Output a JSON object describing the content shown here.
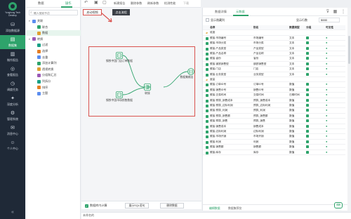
{
  "nav": {
    "logo_text": "Yonghong Tech Desktop",
    "items": [
      {
        "label": "添加数据源",
        "icon": "database-icon"
      },
      {
        "label": "数据集",
        "icon": "dataset-icon"
      },
      {
        "label": "制作报告",
        "icon": "report-icon"
      },
      {
        "label": "查看报告",
        "icon": "view-icon"
      },
      {
        "label": "调度任务",
        "icon": "schedule-icon"
      },
      {
        "label": "深度分析",
        "icon": "analysis-icon"
      },
      {
        "label": "管理系统",
        "icon": "manage-icon"
      },
      {
        "label": "消息中心",
        "icon": "message-icon"
      },
      {
        "label": "个人中心",
        "icon": "user-icon"
      }
    ],
    "active_index": 1
  },
  "tree": {
    "tabs": [
      "数据",
      "操作"
    ],
    "search_placeholder": "输入搜索节点",
    "nodes": [
      {
        "label": "关联",
        "level": 0,
        "expanded": true
      },
      {
        "label": "联合",
        "level": 1
      },
      {
        "label": "数据",
        "level": 1
      },
      {
        "label": "转换",
        "level": 0,
        "expanded": true
      },
      {
        "label": "过滤",
        "level": 1
      },
      {
        "label": "选择",
        "level": 1
      },
      {
        "label": "去重",
        "level": 1
      },
      {
        "label": "添加计算列",
        "level": 1
      },
      {
        "label": "透视转换",
        "level": 1
      },
      {
        "label": "分组和汇总",
        "level": 1
      },
      {
        "label": "列拆分",
        "level": 1
      },
      {
        "label": "排序",
        "level": 1
      },
      {
        "label": "主题",
        "level": 1
      }
    ]
  },
  "toolbar": {
    "buttons": [
      "新建报告",
      "删除参数",
      "刷新参数",
      "检测性能",
      "下载"
    ]
  },
  "canvas": {
    "tabs": [
      "启动视频",
      "点击流程"
    ],
    "nodes": [
      {
        "label": "钢铁中国门店订单数据"
      },
      {
        "label": "钢铁中国市场销售数据"
      },
      {
        "label": "联接"
      },
      {
        "label": "数据集输出"
      }
    ],
    "footer": {
      "checkbox_label": "数据库内计算",
      "sql_button": "展示SQL语句",
      "delete_button": "删除数据"
    }
  },
  "bottom_tab": "未命名的",
  "right_panel": {
    "tabs": [
      "数据详情",
      "元数据"
    ],
    "show_hidden_label": "显示隐藏列",
    "row_count_label": "显示行数",
    "row_count_value": "5000",
    "headers": [
      "名称",
      "别名",
      "数据类型",
      "分组",
      "可见性"
    ],
    "groups": [
      {
        "name": "维度",
        "rows": [
          {
            "name": "联接.市场编号",
            "alias": "市场编号",
            "type": "文本"
          },
          {
            "name": "联接.市场分类",
            "alias": "市场分类",
            "type": "文本"
          },
          {
            "name": "联接.产品类型",
            "alias": "产品类型",
            "type": "文本"
          },
          {
            "name": "联接.产品名称",
            "alias": "产品名称",
            "type": "文本"
          },
          {
            "name": "联接.省份",
            "alias": "省份",
            "type": "文本"
          },
          {
            "name": "联接.钢铁销售型",
            "alias": "钢铁销售型",
            "type": "文本"
          },
          {
            "name": "联接.门店",
            "alias": "门店",
            "type": "文本"
          },
          {
            "name": "联接.业务类型",
            "alias": "业务类型",
            "type": "文本"
          }
        ]
      },
      {
        "name": "度量",
        "rows": [
          {
            "name": "联接.订单ID号",
            "alias": "订单ID号",
            "type": "数值"
          },
          {
            "name": "联接.销售ID号",
            "alias": "销售ID号",
            "type": "数值"
          },
          {
            "name": "联接.交易时间",
            "alias": "交易时间",
            "type": "日期时间"
          },
          {
            "name": "联接.预算_销售成本",
            "alias": "预算_销售成本",
            "type": "数值"
          },
          {
            "name": "联接.预算_边际利润",
            "alias": "预算_边际利润",
            "type": "数值"
          },
          {
            "name": "联接.预算_利润",
            "alias": "预算_利润",
            "type": "数值"
          },
          {
            "name": "联接.预算_销售额",
            "alias": "预算_销售额",
            "type": "数值"
          },
          {
            "name": "联接.预算_销售",
            "alias": "预算_销售",
            "type": "数值"
          },
          {
            "name": "联接.销售成本",
            "alias": "销售成本",
            "type": "数值"
          },
          {
            "name": "联接.边际利润",
            "alias": "边际利润",
            "type": "数值"
          },
          {
            "name": "联接.市场开销",
            "alias": "市场开销",
            "type": "数值"
          },
          {
            "name": "联接.利润",
            "alias": "利润",
            "type": "数值"
          },
          {
            "name": "联接.销售额",
            "alias": "销售额",
            "type": "数值"
          },
          {
            "name": "联接.库存",
            "alias": "库存",
            "type": "数值"
          }
        ]
      }
    ],
    "footer": [
      "编辑数据",
      "数据集预览"
    ]
  },
  "colors": {
    "accent": "#2ea36b",
    "highlight": "#d9534f",
    "nav_bg": "#1f2937"
  }
}
